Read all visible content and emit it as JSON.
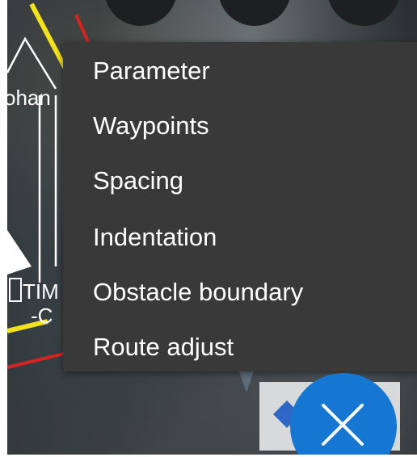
{
  "map": {
    "labels": {
      "left_name": "ohan",
      "tim": "TIM",
      "c": "-C"
    }
  },
  "menu": {
    "items": [
      {
        "label": "Parameter"
      },
      {
        "label": "Waypoints"
      },
      {
        "label": "Spacing"
      },
      {
        "label": "Indentation"
      },
      {
        "label": "Obstacle boundary"
      },
      {
        "label": "Route adjust"
      }
    ]
  },
  "fab": {
    "icon": "close-icon",
    "color": "#1677d2"
  },
  "colors": {
    "menu_background": "#393939",
    "menu_text": "#ffffff",
    "boundary_yellow": "#f2e21b",
    "boundary_red": "#d8231f"
  }
}
